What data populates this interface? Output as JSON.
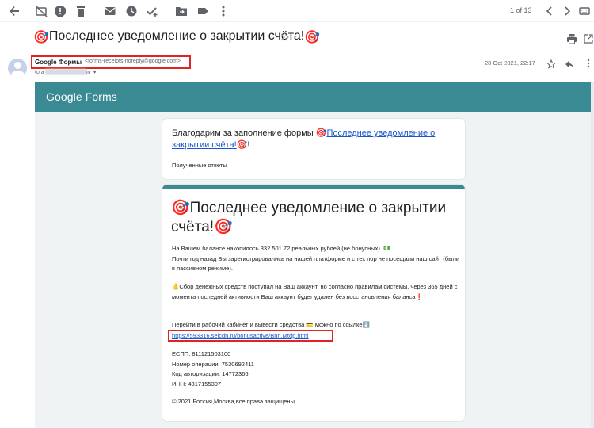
{
  "toolbar": {
    "icons": [
      "back-arrow-icon",
      "archive-off-icon",
      "report-spam-icon",
      "delete-icon",
      "mark-unread-icon",
      "snooze-icon",
      "add-task-icon",
      "move-to-icon",
      "label-icon",
      "more-vert-icon"
    ],
    "pager": "1 of 13"
  },
  "email": {
    "subject": "Последнее уведомление о закрытии счёта!",
    "subject_emoji_left": "🎯",
    "subject_emoji_right": "🎯",
    "sender_name": "Google Формы",
    "sender_email": "<forms-receipts-noreply@google.com>",
    "to_prefix": "to a",
    "to_suffix": "in",
    "date": "28 Oct 2021, 22:17"
  },
  "forms": {
    "logo": "Google Forms",
    "thanks_prefix": "Благодарим за заполнение формы ",
    "thanks_link": "Последнее уведомление о закрытии счёта!",
    "thanks_suffix": "!",
    "received": "Полученные ответы",
    "title": "Последнее уведомление о закрытии счёта!",
    "p1_line1": "На Вашем балансе накопилось 332 501.72 реальных рублей (не бонусных). 💵",
    "p1_line2": "Почти год назад Вы зарегистрировались на нашей платформе и с тех пор не посещали наш сайт (были в пассивном режиме).",
    "p2": "🔔Сбор денежных средств поступал на Ваш аккаунт, но согласно правилам системы, через 365 дней с момента последней активности Ваш аккаунт будет удален без восстановления баланса❗",
    "p3": "Перейти в рабочий кабинет и вывести средства 💳 можно по ссылке⬇️",
    "link": "https://593316.selcdn.ru/bonusactive/Bnrl.Mtdp.html",
    "espp": "ЕСПП: 811121503100",
    "op_number": "Номер операции: 7530692411",
    "auth_code": "Код авторизации: 14772366",
    "inn": "ИНН: 4317155307",
    "footer": "© 2021,Россия,Москва,все права защищены"
  },
  "colors": {
    "forms_teal": "#3a8a94",
    "highlight_red": "#e02424",
    "link_blue": "#1a56c7"
  }
}
